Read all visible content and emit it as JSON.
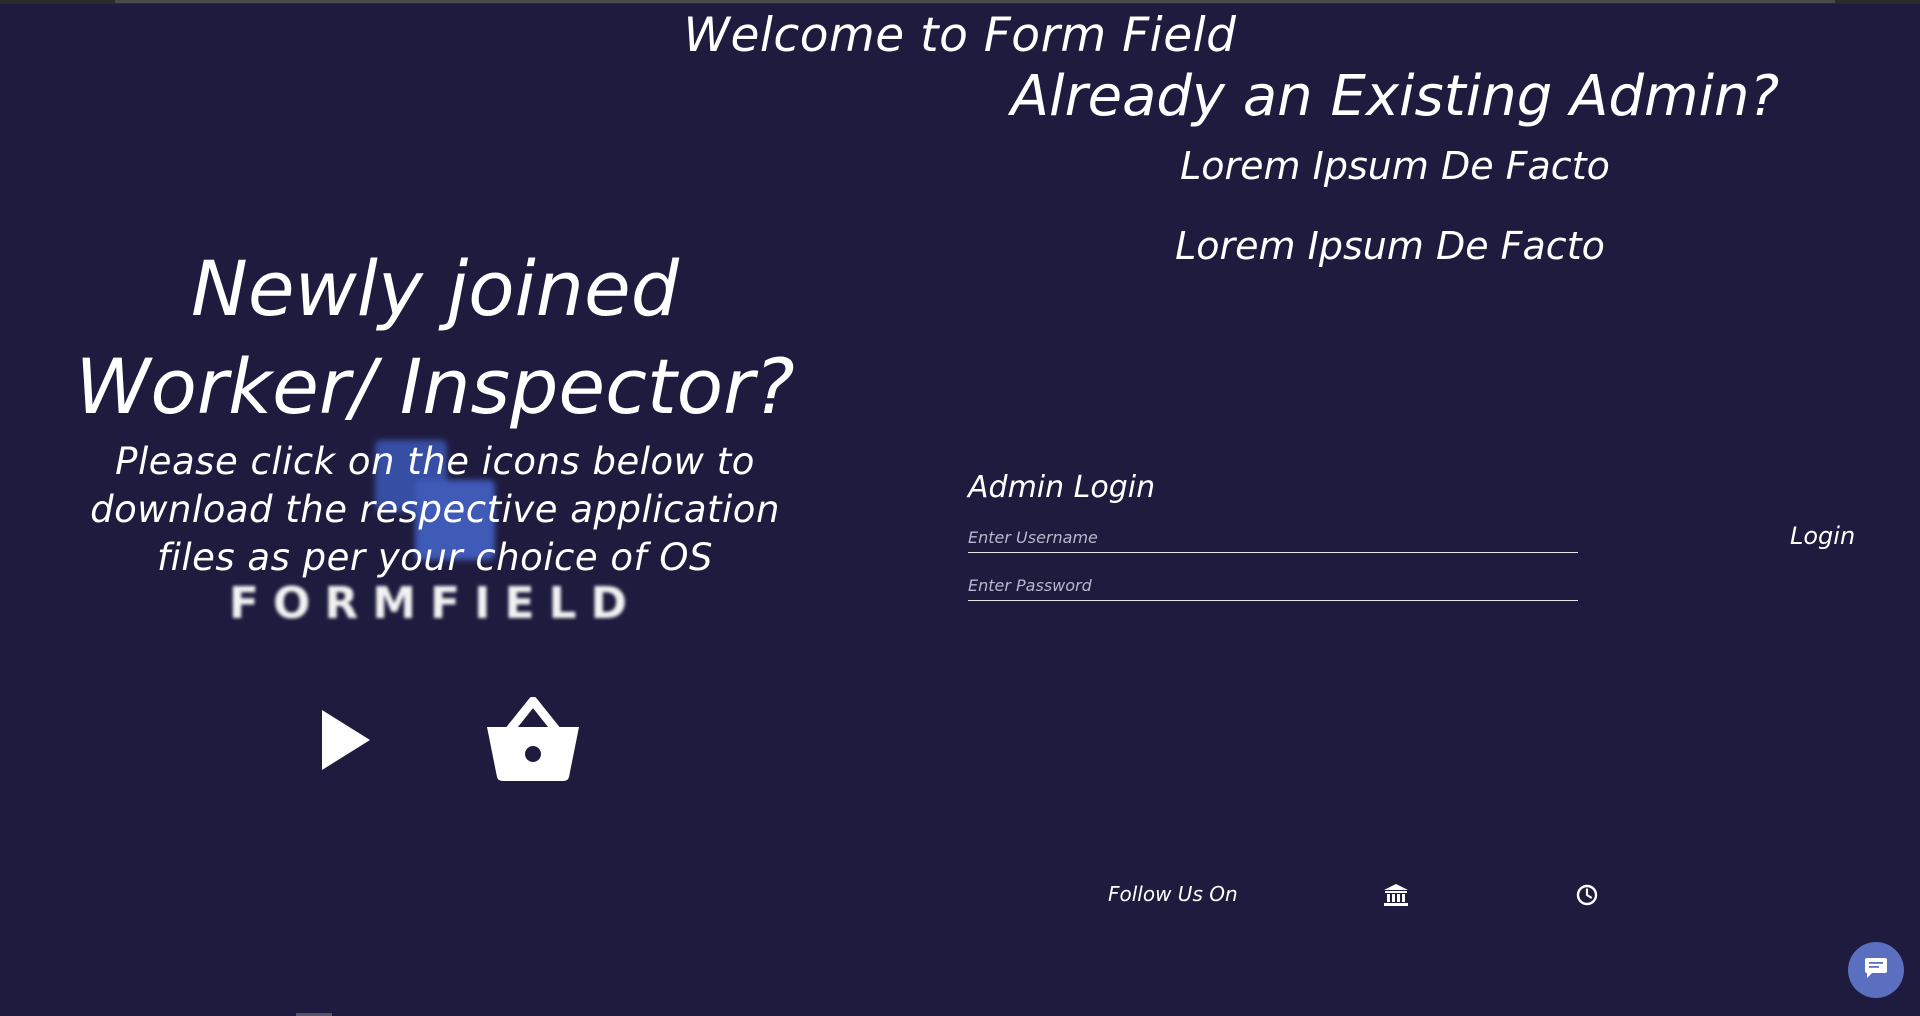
{
  "header": {
    "welcome_title": "Welcome to Form Field"
  },
  "admin_section": {
    "heading": "Already an Existing Admin?",
    "tagline_1": "Lorem Ipsum De Facto",
    "tagline_2": "Lorem Ipsum De Facto",
    "login_title": "Admin Login",
    "username_placeholder": "Enter Username",
    "username_value": "",
    "password_placeholder": "Enter Password",
    "password_value": "",
    "login_label": "Login"
  },
  "worker_section": {
    "heading": "Newly joined Worker/ Inspector?",
    "instructions": "Please click on the icons below to download the respective application files as per your choice of OS",
    "brand_wordmark": "FORMFIELD",
    "download_icons": [
      "play-store-icon",
      "basket-store-icon"
    ]
  },
  "footer": {
    "follow_label": "Follow Us On",
    "social_icons": [
      "bank-icon",
      "clock-icon"
    ]
  },
  "chat": {
    "icon": "chat-bubble-icon"
  },
  "colors": {
    "background": "#1e1b3e",
    "text": "#ffffff",
    "chat_button": "#5b6fc0",
    "logo_blue": "#4a6fe0"
  }
}
